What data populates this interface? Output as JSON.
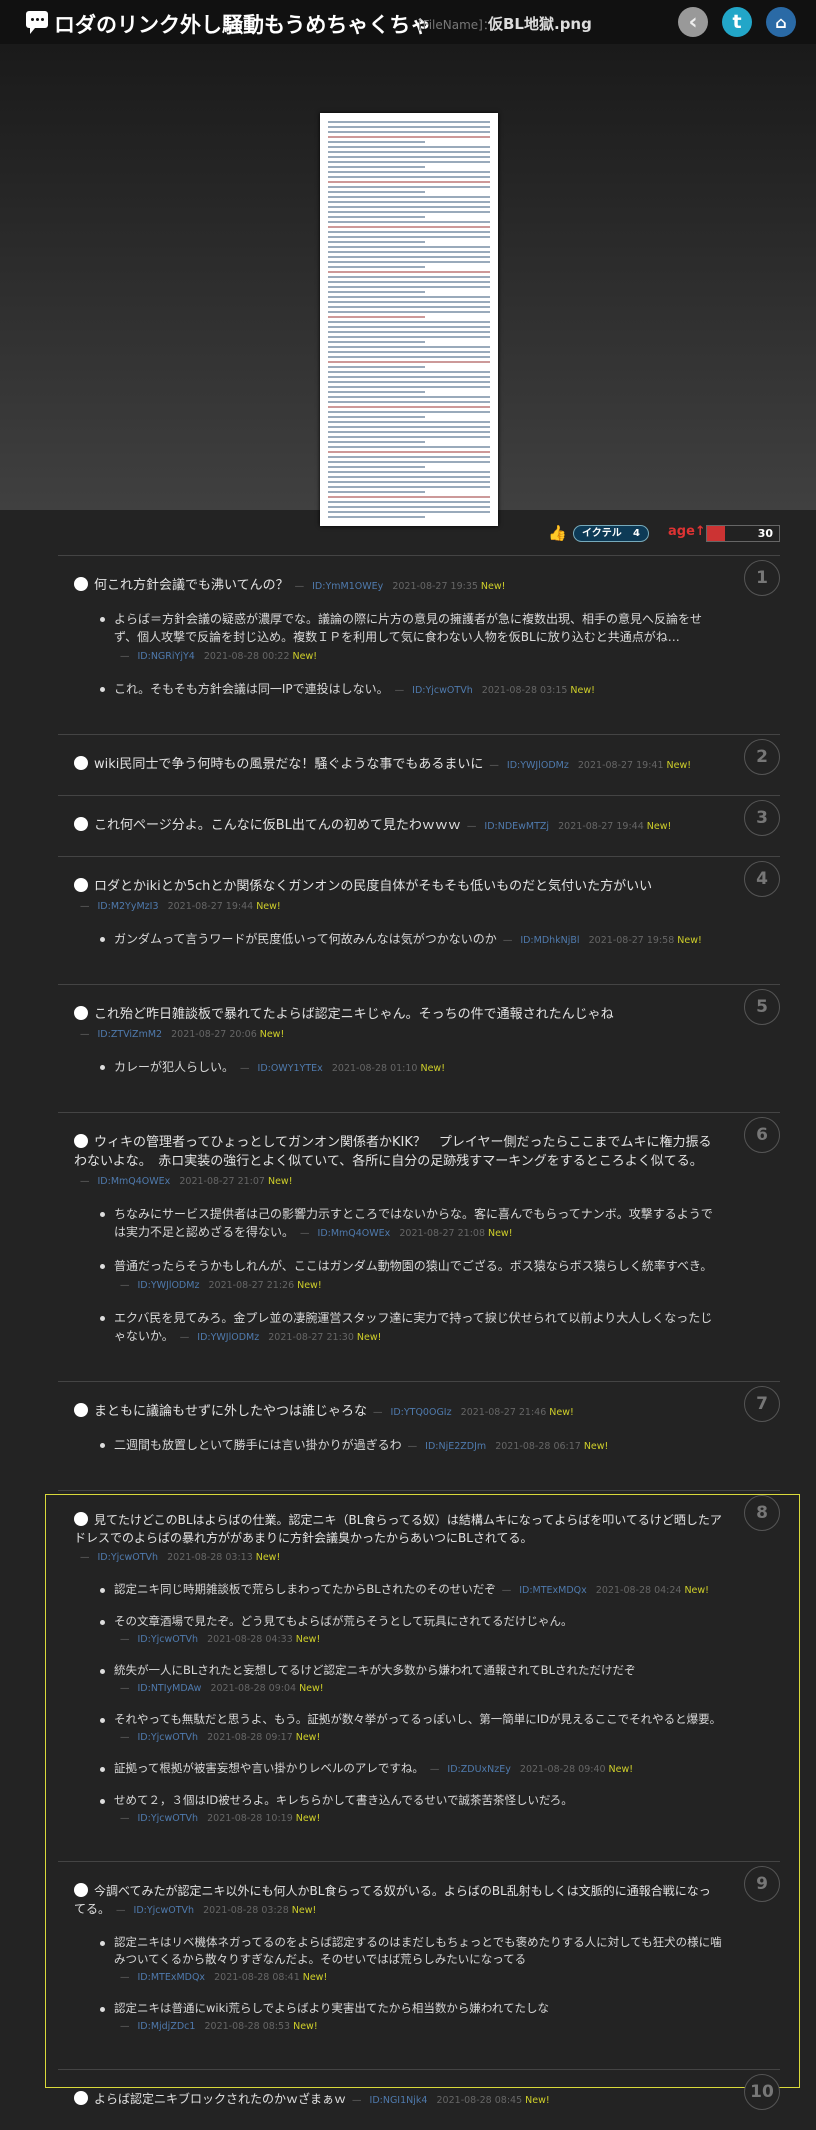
{
  "header": {
    "title": "ロダのリンク外し騒動もうめちゃくちゃ",
    "filename_label": "[FileName]：",
    "filename": "仮BL地獄.png",
    "back_icon": "back-arrow-icon",
    "twitter_icon": "twitter-icon",
    "home_icon": "home-icon"
  },
  "actions": {
    "ikuteru_label": "イクテル",
    "ikuteru_count": "4",
    "age_label": "age",
    "age_value": "30",
    "age_fill": 0.25,
    "colors": {
      "age": "#cc3333",
      "new": "#cfcf2a",
      "id": "#4f7aad"
    }
  },
  "posts": [
    {
      "num": "1",
      "text": "何これ方針会議でも沸いてんの？",
      "id": "ID:YmM1OWEy",
      "date": "2021-08-27 19:35",
      "new": "New!",
      "replies": [
        {
          "text": "よらば＝方針会議の疑惑が濃厚でな。議論の際に片方の意見の擁護者が急に複数出現、相手の意見へ反論をせず、個人攻撃で反論を封じ込め。複数ＩＰを利用して気に食わない人物を仮BLに放り込むと共通点がね…",
          "id": "ID:NGRiYjY4",
          "date": "2021-08-28 00:22",
          "new": "New!"
        },
        {
          "text": "これ。そもそも方針会議は同一IPで連投はしない。",
          "id": "ID:YjcwOTVh",
          "date": "2021-08-28 03:15",
          "new": "New!"
        }
      ]
    },
    {
      "num": "2",
      "text": "wiki民同士で争う何時もの風景だな！騒ぐような事でもあるまいに",
      "id": "ID:YWJlODMz",
      "date": "2021-08-27 19:41",
      "new": "New!",
      "replies": []
    },
    {
      "num": "3",
      "text": "これ何ページ分よ。こんなに仮BL出てんの初めて見たわｗｗｗ",
      "id": "ID:NDEwMTZj",
      "date": "2021-08-27 19:44",
      "new": "New!",
      "replies": []
    },
    {
      "num": "4",
      "text": "ロダとかikiとか5chとか関係なくガンオンの民度自体がそもそも低いものだと気付いた方がいい",
      "id": "ID:M2YyMzI3",
      "date": "2021-08-27 19:44",
      "new": "New!",
      "replies": [
        {
          "text": "ガンダムって言うワードが民度低いって何故みんなは気がつかないのか",
          "id": "ID:MDhkNjBl",
          "date": "2021-08-27 19:58",
          "new": "New!"
        }
      ]
    },
    {
      "num": "5",
      "text": "これ殆ど昨日雑談板で暴れてたよらば認定ニキじゃん。そっちの件で通報されたんじゃね",
      "id": "ID:ZTViZmM2",
      "date": "2021-08-27 20:06",
      "new": "New!",
      "replies": [
        {
          "text": "カレーが犯人らしい。",
          "id": "ID:OWY1YTEx",
          "date": "2021-08-28 01:10",
          "new": "New!"
        }
      ]
    },
    {
      "num": "6",
      "text": "ウィキの管理者ってひょっとしてガンオン関係者かKIK？　プレイヤー側だったらここまでムキに権力振るわないよな。　赤ロ実装の強行とよく似ていて、各所に自分の足跡残すマーキングをするところよく似てる。",
      "id": "ID:MmQ4OWEx",
      "date": "2021-08-27 21:07",
      "new": "New!",
      "replies": [
        {
          "text": "ちなみにサービス提供者は己の影響力示すところではないからな。客に喜んでもらってナンボ。攻撃するようでは実力不足と認めざるを得ない。",
          "id": "ID:MmQ4OWEx",
          "date": "2021-08-27 21:08",
          "new": "New!"
        },
        {
          "text": "普通だったらそうかもしれんが、ここはガンダム動物園の猿山でござる。ボス猿ならボス猿らしく統率すべき。",
          "id": "ID:YWJlODMz",
          "date": "2021-08-27 21:26",
          "new": "New!"
        },
        {
          "text": "エクバ民を見てみろ。金プレ並の凄腕運営スタッフ達に実力で持って捩じ伏せられて以前より大人しくなったじゃないか。",
          "id": "ID:YWJlODMz",
          "date": "2021-08-27 21:30",
          "new": "New!"
        }
      ]
    },
    {
      "num": "7",
      "text": "まともに議論もせずに外したやつは誰じゃろな",
      "id": "ID:YTQ0OGIz",
      "date": "2021-08-27 21:46",
      "new": "New!",
      "replies": [
        {
          "text": "二週間も放置しといて勝手には言い掛かりが過ぎるわ",
          "id": "ID:NjE2ZDJm",
          "date": "2021-08-28 06:17",
          "new": "New!"
        }
      ]
    },
    {
      "num": "8",
      "text": "見てたけどこのBLはよらばの仕業。認定ニキ（BL食らってる奴）は結構ムキになってよらばを叩いてるけど晒したアドレスでのよらばの暴れ方ががあまりに方針会議臭かったからあいつにBLされてる。",
      "id": "ID:YjcwOTVh",
      "date": "2021-08-28 03:13",
      "new": "New!",
      "replies": [
        {
          "text": "認定ニキ同じ時期雑談板で荒らしまわってたからBLされたのそのせいだぞ",
          "id": "ID:MTExMDQx",
          "date": "2021-08-28 04:24",
          "new": "New!"
        },
        {
          "text": "その文章酒場で見たぞ。どう見てもよらばが荒らそうとして玩具にされてるだけじゃん。",
          "id": "ID:YjcwOTVh",
          "date": "2021-08-28 04:33",
          "new": "New!"
        },
        {
          "text": "統失が一人にBLされたと妄想してるけど認定ニキが大多数から嫌われて通報されてBLされただけだぞ",
          "id": "ID:NTIyMDAw",
          "date": "2021-08-28 09:04",
          "new": "New!"
        },
        {
          "text": "それやっても無駄だと思うよ、もう。証拠が数々挙がってるっぽいし、第一簡単にIDが見えるここでそれやると爆要。",
          "id": "ID:YjcwOTVh",
          "date": "2021-08-28 09:17",
          "new": "New!"
        },
        {
          "text": "証拠って根拠が被害妄想や言い掛かりレベルのアレですね。",
          "id": "ID:ZDUxNzEy",
          "date": "2021-08-28 09:40",
          "new": "New!"
        },
        {
          "text": "せめて２，３個はID被せろよ。キレちらかして書き込んでるせいで誠茶苦茶怪しいだろ。",
          "id": "ID:YjcwOTVh",
          "date": "2021-08-28 10:19",
          "new": "New!"
        }
      ]
    },
    {
      "num": "9",
      "text": "今調べてみたが認定ニキ以外にも何人かBL食らってる奴がいる。よらばのBL乱射もしくは文脈的に通報合戦になってる。",
      "id": "ID:YjcwOTVh",
      "date": "2021-08-28 03:28",
      "new": "New!",
      "replies": [
        {
          "text": "認定ニキはリベ機体ネガってるのをよらば認定するのはまだしもちょっとでも褒めたりする人に対しても狂犬の様に噛みついてくるから散々りすぎなんだよ。そのせいではば荒らしみたいになってる",
          "id": "ID:MTExMDQx",
          "date": "2021-08-28 08:41",
          "new": "New!"
        },
        {
          "text": "認定ニキは普通にwiki荒らしでよらばより実害出てたから相当数から嫌われてたしな",
          "id": "ID:MjdjZDc1",
          "date": "2021-08-28 08:53",
          "new": "New!"
        }
      ]
    },
    {
      "num": "10",
      "text": "よらば認定ニキブロックされたのかｗざまぁｗ",
      "id": "ID:NGI1Njk4",
      "date": "2021-08-28 08:45",
      "new": "New!",
      "replies": []
    }
  ]
}
